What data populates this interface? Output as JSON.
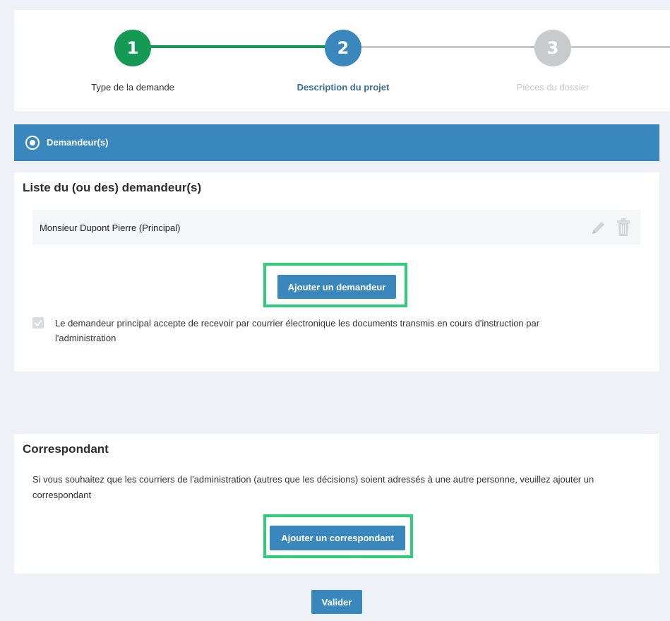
{
  "stepper": {
    "steps": [
      {
        "number": "1",
        "label": "Type de la demande",
        "state": "completed"
      },
      {
        "number": "2",
        "label": "Description du projet",
        "state": "active"
      },
      {
        "number": "3",
        "label": "Pièces du dossier",
        "state": "upcoming"
      }
    ]
  },
  "section": {
    "icon": "radio-selected-icon",
    "title": "Demandeur(s)"
  },
  "applicants": {
    "title": "Liste du (ou des) demandeur(s)",
    "items": [
      {
        "name": "Monsieur Dupont Pierre (Principal)",
        "actions": [
          "pencil-icon",
          "trash-icon"
        ]
      }
    ],
    "add_button": "Ajouter un demandeur",
    "consent_checked": true,
    "consent_text_line1": "Le demandeur principal accepte de recevoir par courrier électronique les documents transmis en cours d'instruction par",
    "consent_text_line2": "l'administration"
  },
  "correspondent": {
    "title": "Correspondant",
    "text_line1": "Si vous souhaitez que les courriers de l'administration (autres que les décisions) soient adressés à une autre personne, veuillez ajouter un",
    "text_line2": "correspondant",
    "add_button": "Ajouter un correspondant"
  },
  "footer": {
    "submit_button": "Valider"
  },
  "colors": {
    "completed": "#159a55",
    "active": "#3a87be",
    "upcoming": "#c8cacc",
    "highlight": "#2fcc7a"
  }
}
